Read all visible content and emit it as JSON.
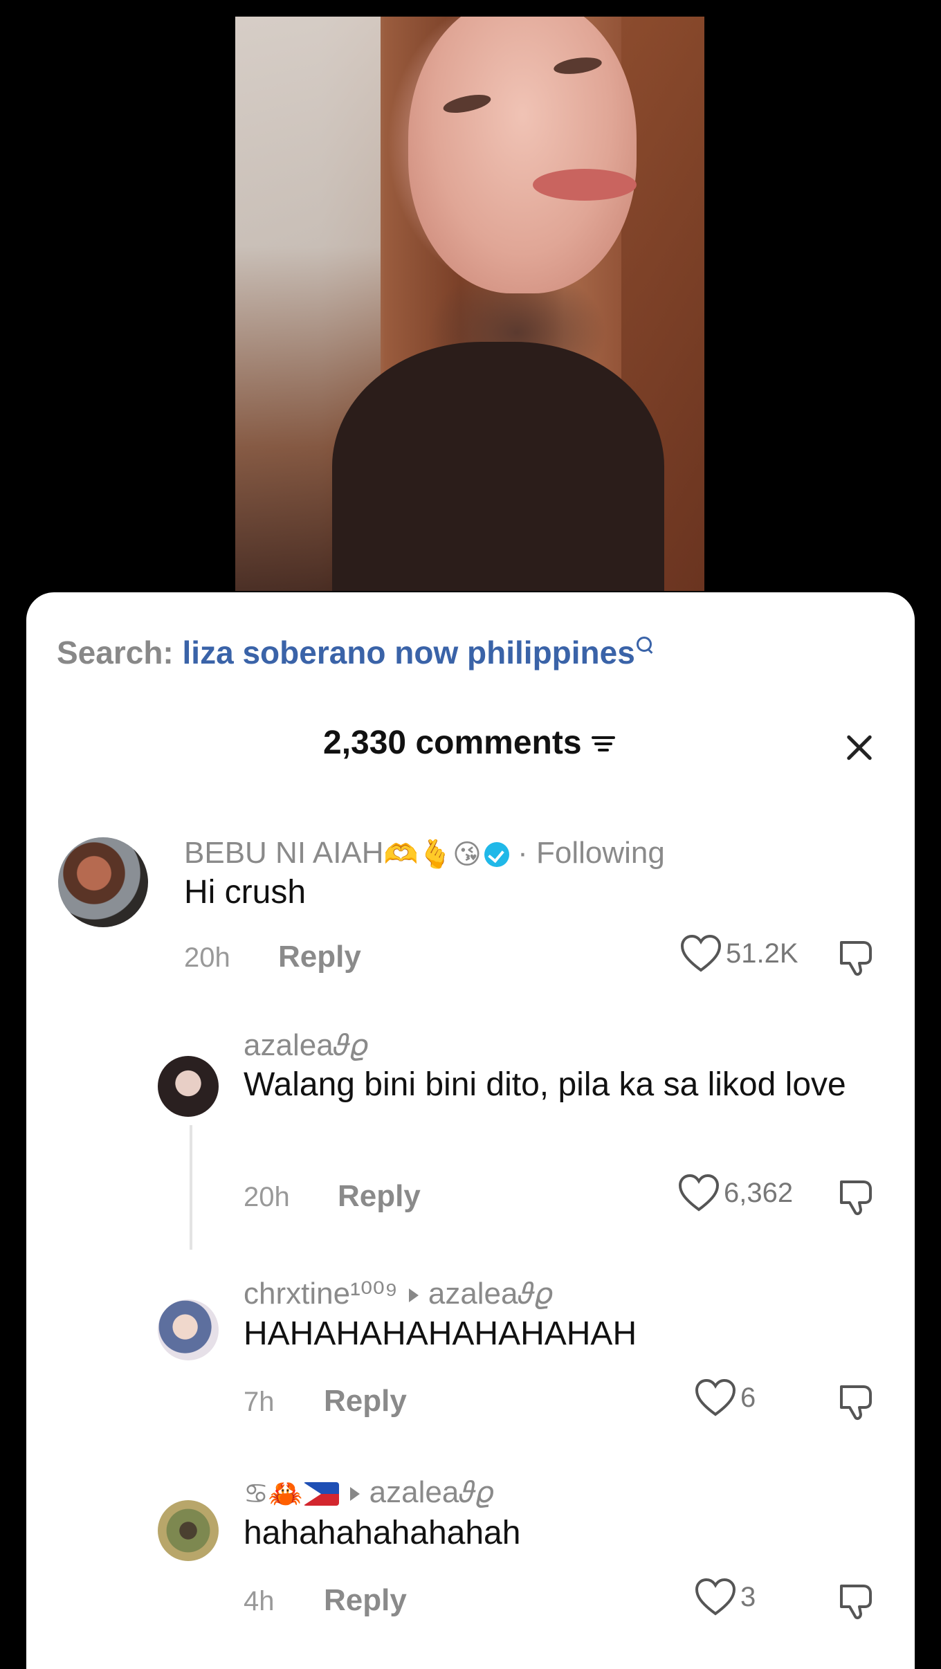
{
  "video": {
    "label": ""
  },
  "search": {
    "label": "Search:",
    "term": "liza soberano now philippines"
  },
  "header": {
    "title": "2,330 comments"
  },
  "comments": [
    {
      "username": "BEBU NI AIAH",
      "username_emoji": [
        "🫶",
        "🫰",
        "😘"
      ],
      "verified": true,
      "following": "· Following",
      "text": "Hi crush",
      "time": "20h",
      "reply": "Reply",
      "likes": "51.2K"
    },
    {
      "username": "azalea𝜗𝜚",
      "text": "Walang bini bini dito, pila ka sa likod love",
      "time": "20h",
      "reply": "Reply",
      "likes": "6,362"
    },
    {
      "username": "chrxtine¹⁰⁰⁹",
      "reply_to": "azalea𝜗𝜚",
      "text": "HAHAHAHAHAHAHAHAH",
      "time": "7h",
      "reply": "Reply",
      "likes": "6"
    },
    {
      "username_emoji": [
        "♋",
        "🦀"
      ],
      "reply_to": "azalea𝜗𝜚",
      "text": "hahahahahahahah",
      "time": "4h",
      "reply": "Reply",
      "likes": "3"
    }
  ],
  "colors": {
    "accent": "#3a63a8",
    "muted": "#8a8a8a",
    "verified": "#20b8e8"
  },
  "icons": [
    "search-icon",
    "filter-icon",
    "close-icon",
    "heart-icon",
    "dislike-icon",
    "verified-icon"
  ]
}
